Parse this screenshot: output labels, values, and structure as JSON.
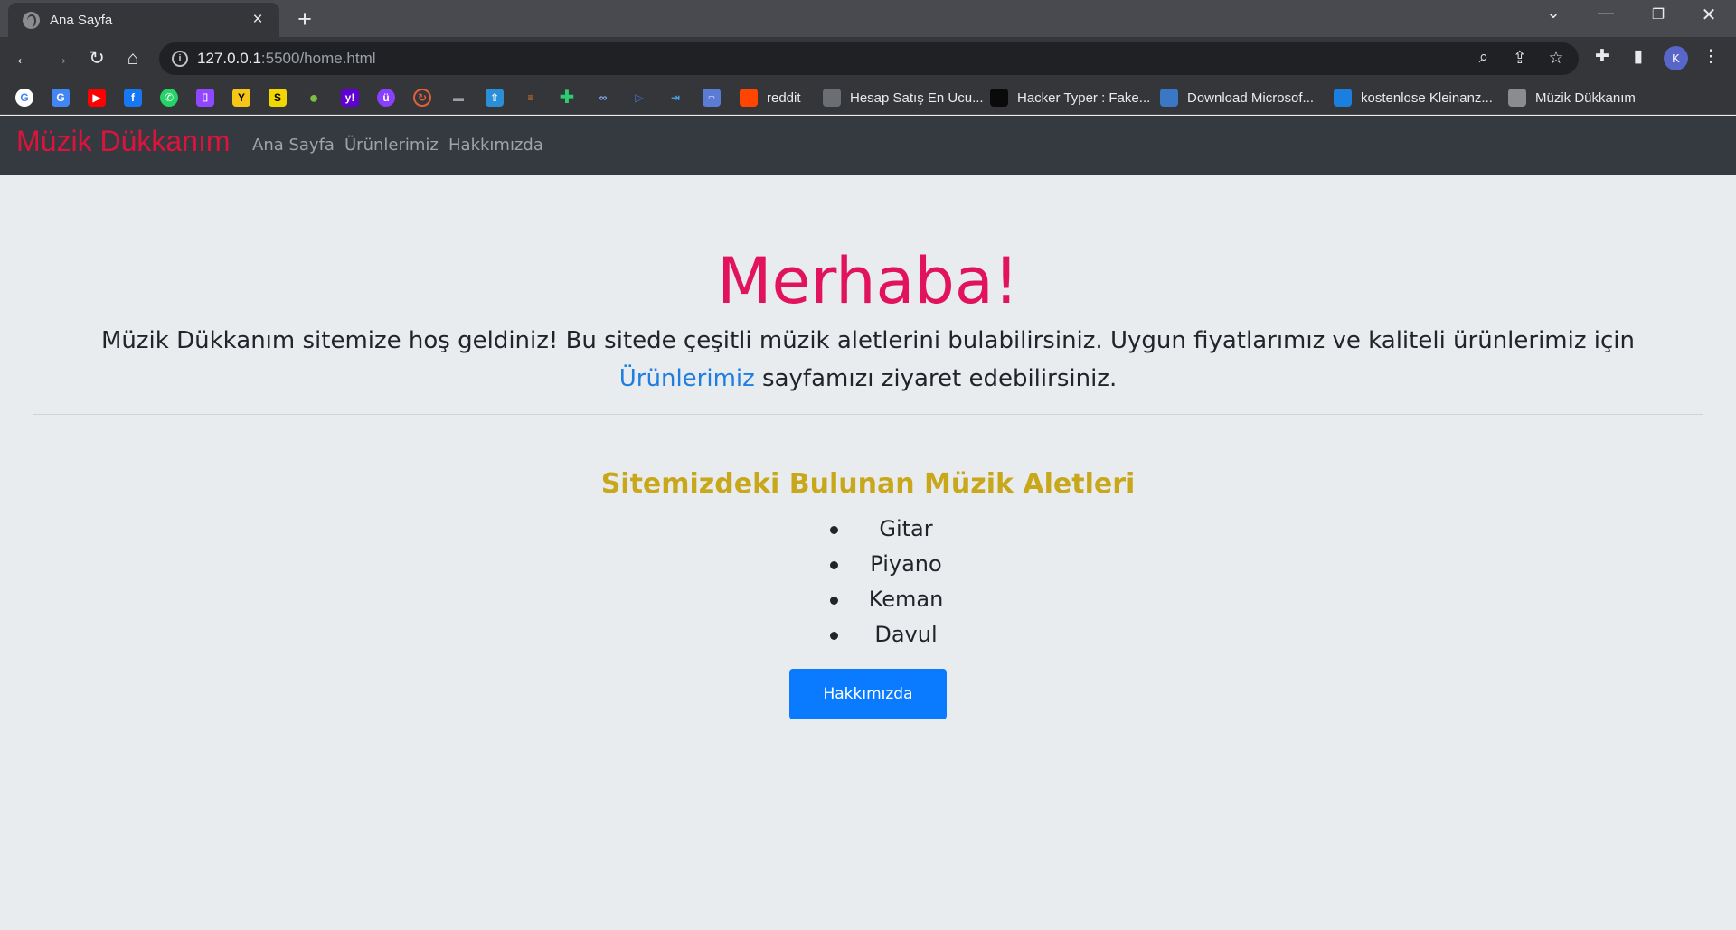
{
  "browser": {
    "tab_title": "Ana Sayfa",
    "url_host": "127.0.0.1",
    "url_rest": ":5500/home.html",
    "profile_initial": "K",
    "bookmarks": [
      {
        "label": "reddit",
        "icon": "reddit-icon",
        "color": "#ff4500"
      },
      {
        "label": "Hesap Satış En Ucu...",
        "icon": "bookmark-person-icon",
        "color": "#6b6e73"
      },
      {
        "label": "Hacker Typer : Fake...",
        "icon": "hacker-typer-icon",
        "color": "#0a0a0a"
      },
      {
        "label": "Download Microsof...",
        "icon": "download-icon",
        "color": "#3a78c5"
      },
      {
        "label": "kostenlose Kleinanz...",
        "icon": "quoka-icon",
        "color": "#1b7fe0"
      },
      {
        "label": "Müzik Dükkanım",
        "icon": "globe-icon",
        "color": "#8a8c90"
      }
    ]
  },
  "site": {
    "brand": "Müzik Dükkanım",
    "nav": [
      "Ana Sayfa",
      "Ürünlerimiz",
      "Hakkımızda"
    ],
    "hero_title": "Merhaba!",
    "hero_text_before": "Müzik Dükkanım sitemize hoş geldiniz! Bu sitede çeşitli müzik aletlerini bulabilirsiniz. Uygun fiyatlarımız ve kaliteli ürünlerimiz için ",
    "hero_link": "Ürünlerimiz",
    "hero_text_after": " sayfamızı ziyaret edebilirsiniz.",
    "list_title": "Sitemizdeki Bulunan Müzik Aletleri",
    "instruments": [
      "Gitar",
      "Piyano",
      "Keman",
      "Davul"
    ],
    "about_button": "Hakkımızda"
  },
  "colors": {
    "brand": "#dc143c",
    "hero_title": "#e1135b",
    "list_title": "#c8a81a",
    "button": "#0a7bff",
    "link": "#1e7fe0"
  }
}
